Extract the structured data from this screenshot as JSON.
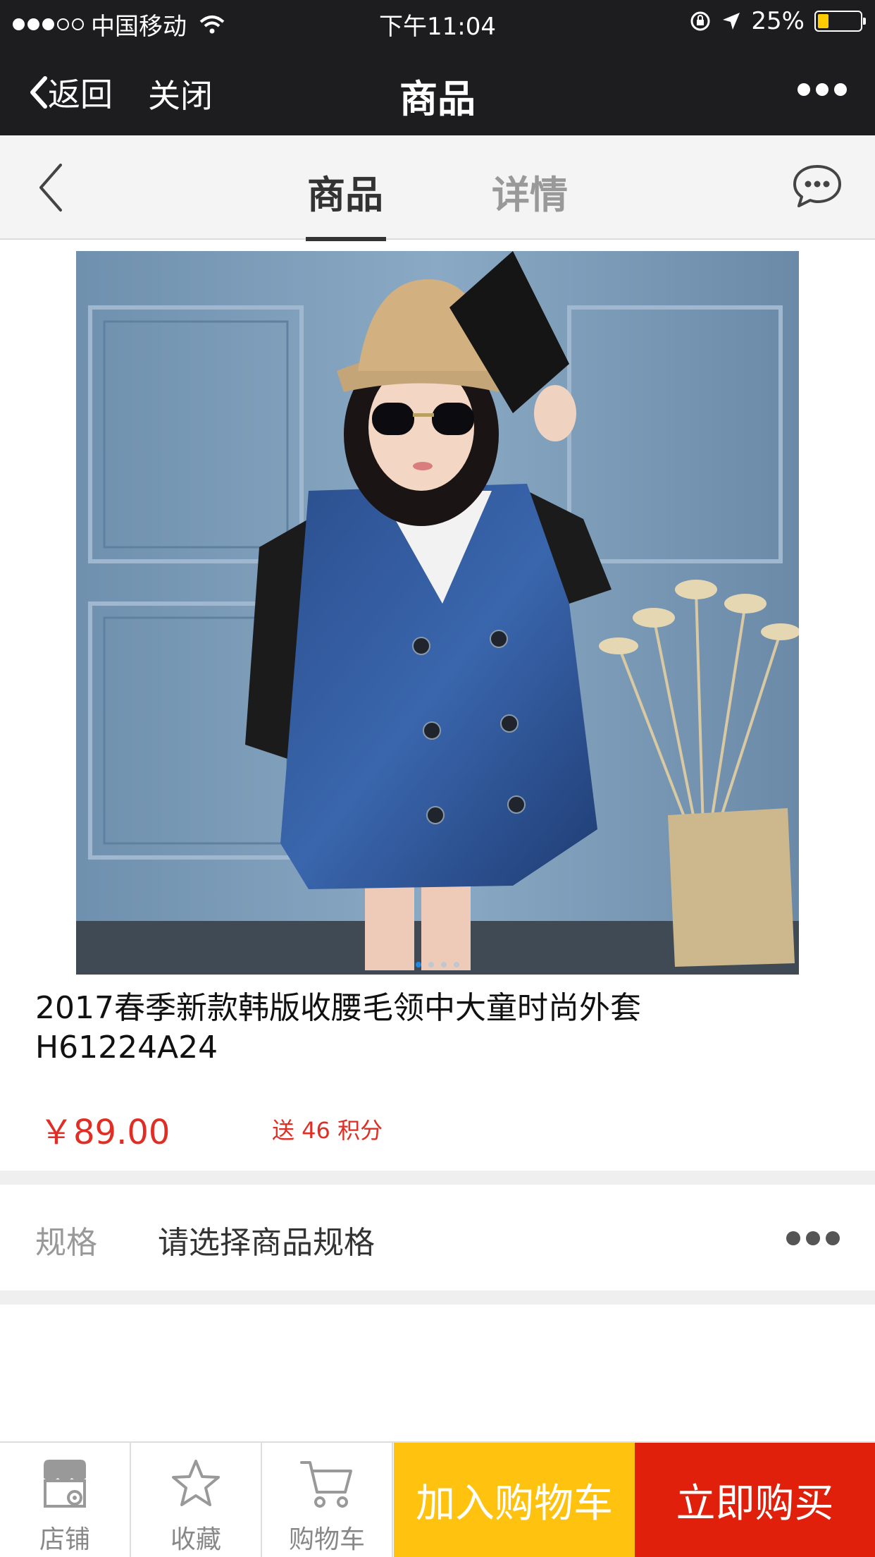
{
  "status_bar": {
    "carrier": "中国移动",
    "time": "下午11:04",
    "battery": "25%",
    "battery_level": 0.25
  },
  "navbar": {
    "back_label": "返回",
    "close_label": "关闭",
    "title": "商品"
  },
  "tabs": [
    {
      "label": "商品",
      "active": true
    },
    {
      "label": "详情",
      "active": false
    }
  ],
  "carousel": {
    "page_count": 4,
    "current_page": 1
  },
  "product": {
    "title": "2017春季新款韩版收腰毛领中大童时尚外套H61224A24",
    "price": "￥89.00",
    "points": "送 46 积分"
  },
  "spec": {
    "label": "规格",
    "value": "请选择商品规格"
  },
  "bottom_bar": {
    "shop_label": "店铺",
    "favorite_label": "收藏",
    "cart_label": "购物车",
    "add_to_cart_label": "加入购物车",
    "buy_now_label": "立即购买"
  },
  "colors": {
    "accent_red": "#e0200a",
    "accent_yellow": "#ffc20e",
    "price_red": "#e02e24"
  }
}
